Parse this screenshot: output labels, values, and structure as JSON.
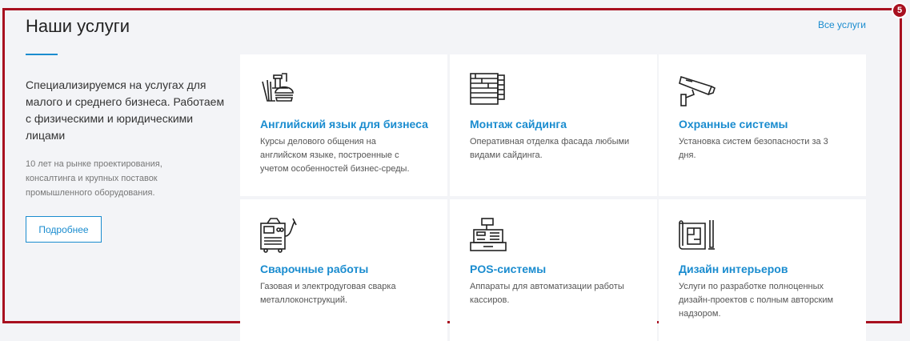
{
  "section": {
    "title": "Наши услуги",
    "all_link": "Все услуги",
    "badge": "5",
    "intro": "Специализируемся на услугах для малого и среднего бизнеса. Работаем с физическими и юридическими лицами",
    "description": "10 лет на рынке проектирования, консалтинга и крупных поставок промышленного оборудования.",
    "more_button": "Подробнее"
  },
  "services": [
    {
      "title": "Английский язык для бизнеса",
      "description": "Курсы делового общения на английском языке, построенные с учетом особенностей бизнес-среды.",
      "icon": "food-icon"
    },
    {
      "title": "Монтаж сайдинга",
      "description": "Оперативная отделка фасада любыми видами сайдинга.",
      "icon": "siding-icon"
    },
    {
      "title": "Охранные системы",
      "description": "Установка систем безопасности за 3 дня.",
      "icon": "security-camera-icon"
    },
    {
      "title": "Сварочные работы",
      "description": "Газовая и электродуговая сварка металлоконструкций.",
      "icon": "welding-machine-icon"
    },
    {
      "title": "POS-системы",
      "description": "Аппараты для автоматизации работы кассиров.",
      "icon": "cash-register-icon"
    },
    {
      "title": "Дизайн интерьеров",
      "description": "Услуги по разработке полноценных дизайн-проектов с полным авторским надзором.",
      "icon": "blueprint-icon"
    }
  ],
  "colors": {
    "accent": "#1a8ccf",
    "frame": "#a8101f"
  }
}
